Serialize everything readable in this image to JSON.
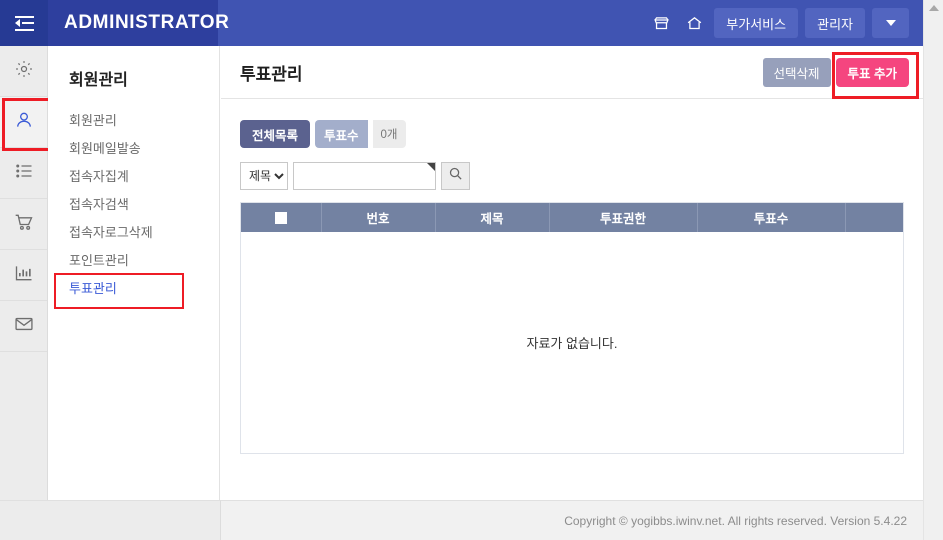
{
  "header": {
    "brand": "ADMINISTRATOR",
    "collapse_icon": "collapse-menu-icon",
    "shop_icon": "shop-icon",
    "home_icon": "home-icon",
    "service_button": "부가서비스",
    "admin_button": "관리자",
    "dropdown_icon": "caret-down-icon",
    "bg_color": "#4054b2",
    "brand_bg_color": "#2e3f9e"
  },
  "rail": {
    "items": [
      {
        "icon": "gear-icon",
        "active": false,
        "highlighted": false
      },
      {
        "icon": "user-icon",
        "active": true,
        "highlighted": true
      },
      {
        "icon": "list-icon",
        "active": false,
        "highlighted": false
      },
      {
        "icon": "cart-icon",
        "active": false,
        "highlighted": false
      },
      {
        "icon": "chart-bar-icon",
        "active": false,
        "highlighted": false
      },
      {
        "icon": "envelope-icon",
        "active": false,
        "highlighted": false
      }
    ],
    "highlight_color": "#ee1c25"
  },
  "sidebar": {
    "title": "회원관리",
    "items": [
      {
        "label": "회원관리",
        "active": false,
        "highlighted": false
      },
      {
        "label": "회원메일발송",
        "active": false,
        "highlighted": false
      },
      {
        "label": "접속자집계",
        "active": false,
        "highlighted": false
      },
      {
        "label": "접속자검색",
        "active": false,
        "highlighted": false
      },
      {
        "label": "접속자로그삭제",
        "active": false,
        "highlighted": false
      },
      {
        "label": "포인트관리",
        "active": false,
        "highlighted": false
      },
      {
        "label": "투표관리",
        "active": true,
        "highlighted": true
      }
    ]
  },
  "page": {
    "title": "투표관리",
    "delete_selected_button": "선택삭제",
    "add_poll_button": "투표 추가",
    "add_poll_color": "#f5457f",
    "delete_button_color": "#97a0bb"
  },
  "tabs": {
    "all_list": "전체목록",
    "vote_count": "투표수",
    "count_badge": "0개",
    "active_color": "#5b628f",
    "alt_color": "#a3aecb"
  },
  "search": {
    "select_value": "제목",
    "select_options": [
      "제목"
    ],
    "input_value": "",
    "input_placeholder": "",
    "search_icon": "magnifier-icon"
  },
  "table": {
    "header_color": "#7382a2",
    "columns": [
      "",
      "번호",
      "제목",
      "투표권한",
      "투표수",
      ""
    ],
    "select_all_checkbox": "select-all-checkbox",
    "rows": [],
    "empty_message": "자료가 없습니다."
  },
  "footer": {
    "copyright": "Copyright © yogibbs.iwinv.net. All rights reserved. Version 5.4.22"
  },
  "scrollbar": {
    "up_arrow_icon": "scroll-up-arrow-icon"
  }
}
